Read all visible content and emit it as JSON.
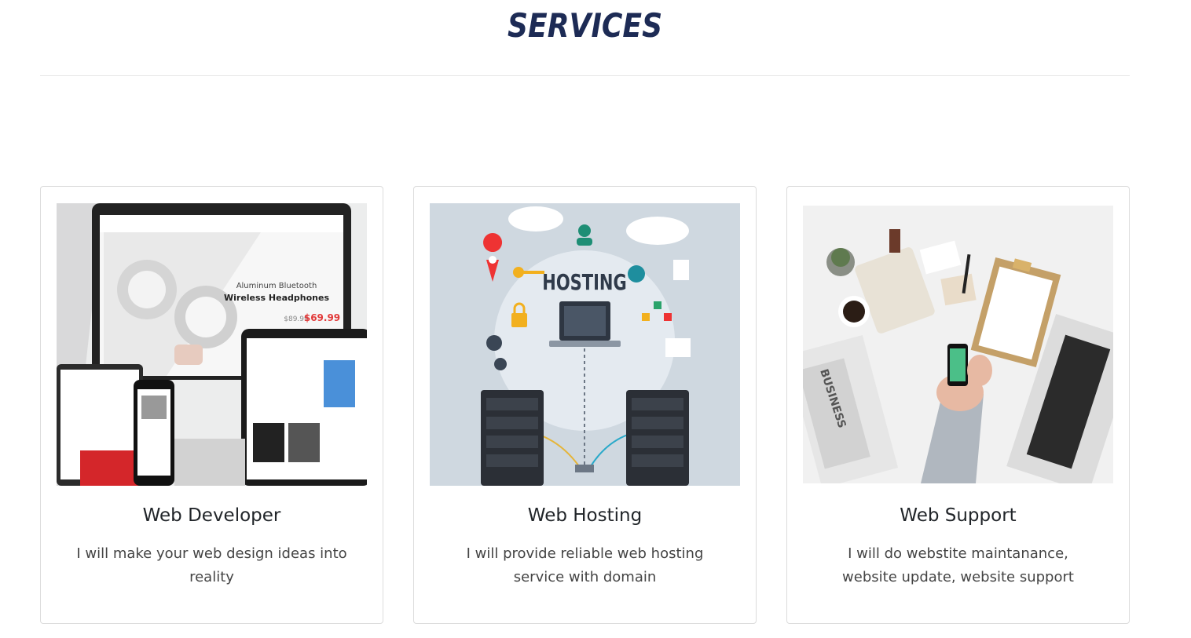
{
  "section": {
    "title": "SERVICES"
  },
  "cards": [
    {
      "image_alt": "web developer devices mockup",
      "title": "Web Developer",
      "text": "I will make your web design ideas into reality",
      "image_text": {
        "line1": "Aluminum Bluetooth",
        "line2": "Wireless Headphones",
        "old_price": "$89.99",
        "price": "$69.99"
      }
    },
    {
      "image_alt": "web hosting illustration",
      "title": "Web Hosting",
      "text": "I will provide reliable web hosting service with domain",
      "image_text": {
        "label": "HOSTING"
      }
    },
    {
      "image_alt": "desk with phone and laptop",
      "title": "Web Support",
      "text": "I will do webstite maintanance, website update, website support",
      "image_text": {
        "newspaper": "BUSINESS"
      }
    }
  ],
  "colors": {
    "title": "#1d2b55",
    "accent_red": "#e23b3b"
  }
}
